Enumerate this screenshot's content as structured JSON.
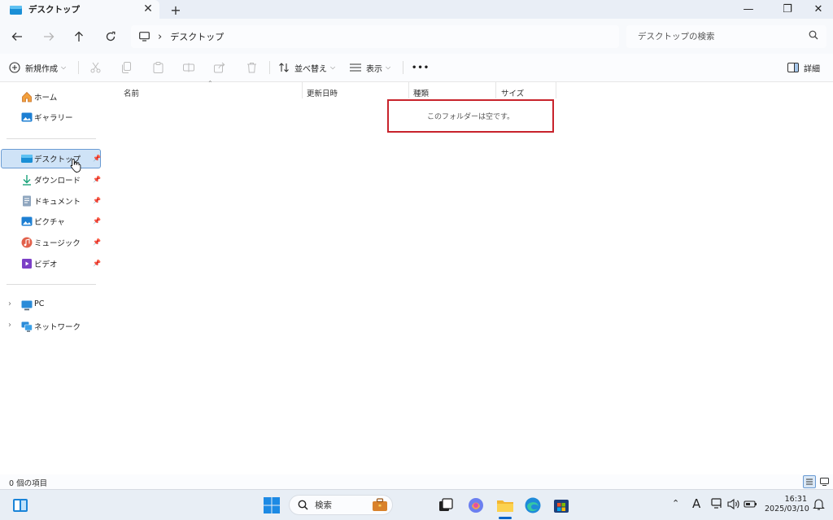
{
  "window": {
    "tab_title": "デスクトップ",
    "new_tab_symbol": "+",
    "controls": {
      "minimize": "—",
      "maximize": "❐",
      "close": "✕"
    }
  },
  "address": {
    "breadcrumb": [
      "デスクトップ"
    ],
    "search_placeholder": "デスクトップの検索"
  },
  "toolbar": {
    "new_label": "新規作成",
    "sort_label": "並べ替え",
    "view_label": "表示",
    "more_label": "•••",
    "details_label": "詳細",
    "disabled_icons": [
      "cut-icon",
      "copy-icon",
      "paste-icon",
      "rename-icon",
      "share-icon",
      "delete-icon"
    ]
  },
  "sidebar": {
    "quick": [
      {
        "label": "ホーム",
        "icon": "home-icon"
      },
      {
        "label": "ギャラリー",
        "icon": "gallery-icon"
      }
    ],
    "pinned": [
      {
        "label": "デスクトップ",
        "icon": "desktop-folder-icon",
        "selected": true
      },
      {
        "label": "ダウンロード",
        "icon": "download-icon"
      },
      {
        "label": "ドキュメント",
        "icon": "documents-icon"
      },
      {
        "label": "ピクチャ",
        "icon": "pictures-icon"
      },
      {
        "label": "ミュージック",
        "icon": "music-icon"
      },
      {
        "label": "ビデオ",
        "icon": "videos-icon"
      }
    ],
    "devices": [
      {
        "label": "PC",
        "icon": "pc-icon"
      },
      {
        "label": "ネットワーク",
        "icon": "network-icon"
      }
    ]
  },
  "content": {
    "columns": [
      "名前",
      "更新日時",
      "種類",
      "サイズ"
    ],
    "empty_message": "このフォルダーは空です。"
  },
  "status": {
    "item_count": "0 個の項目"
  },
  "taskbar": {
    "search_label": "検索",
    "clock_time": "16:31",
    "clock_date": "2025/03/10",
    "ime_label": "A"
  },
  "colors": {
    "accent": "#0a64c8",
    "selection_bg": "#cfe3f7",
    "selection_border": "#6a9bd3",
    "highlight_box": "#c8232c"
  }
}
